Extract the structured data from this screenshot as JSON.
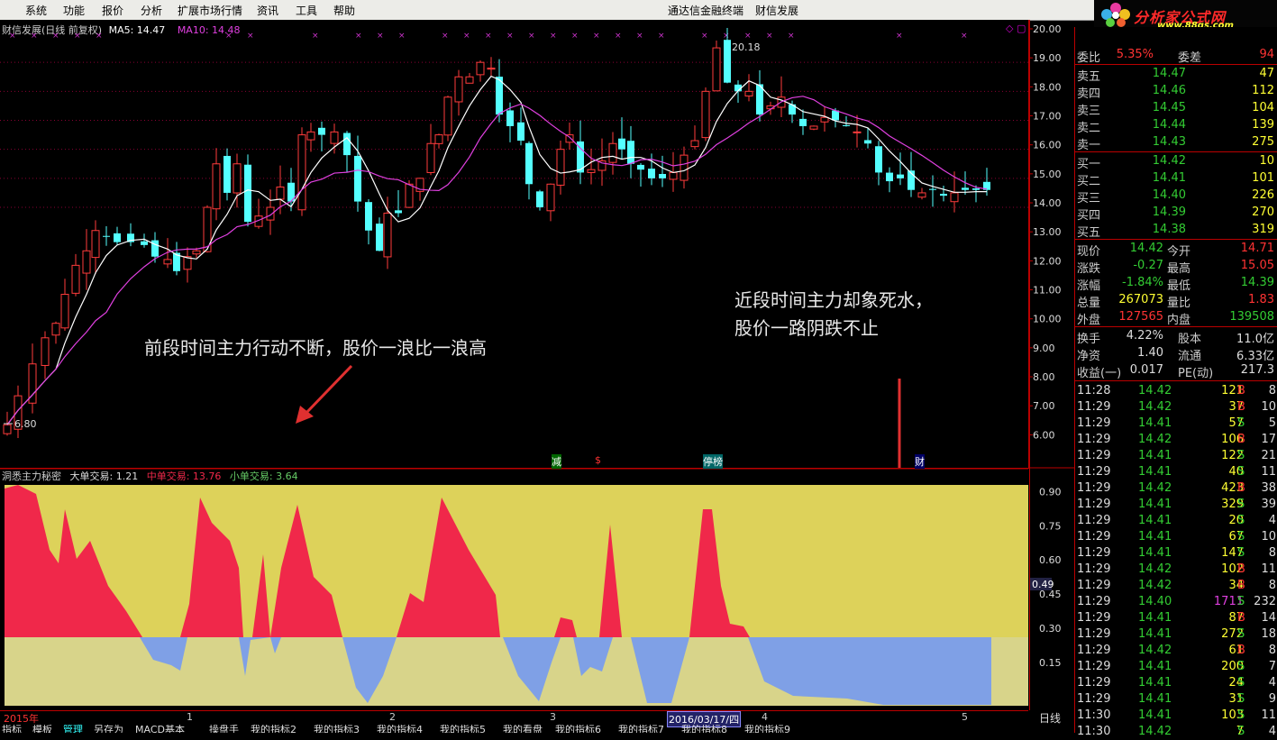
{
  "menu": {
    "items": [
      "系统",
      "功能",
      "报价",
      "分析",
      "扩展市场行情",
      "资讯",
      "工具",
      "帮助"
    ],
    "center_title": "通达信金融终端",
    "stock_name": "财信发展"
  },
  "logo": {
    "text": "分析家公式网",
    "url": "www.88gs.com"
  },
  "kline": {
    "header": "财信发展(日线 前复权)",
    "ma5_label": "MA5: 14.47",
    "ma10_label": "MA10: 14.48",
    "high_label": "20.18",
    "low_label": "6.80",
    "price_axis": [
      "20.00",
      "19.00",
      "18.00",
      "17.00",
      "16.00",
      "15.00",
      "14.00",
      "13.00",
      "12.00",
      "11.00",
      "10.00",
      "9.00",
      "8.00",
      "7.00",
      "6.00"
    ],
    "annotation_left": "前段时间主力行动不断，股价一浪比一浪高",
    "annotation_right_1": "近段时间主力却象死水，",
    "annotation_right_2": "股价一路阴跌不止",
    "event_markers": [
      "减",
      "$",
      "停榜",
      "财"
    ]
  },
  "indicator": {
    "name": "洞悉主力秘密",
    "big": "大单交易: 1.21",
    "mid": "中单交易: 13.76",
    "small": "小单交易: 3.64",
    "axis": [
      "0.90",
      "0.75",
      "0.60",
      "0.45",
      "0.30",
      "0.15"
    ],
    "current": "0.49",
    "colors": {
      "up": "#f0284a",
      "down": "#7fa0e6",
      "bg_top": "#ddd25a",
      "bg_bottom": "#d8d48a"
    }
  },
  "timeline": {
    "year": "2015年",
    "months": [
      "1",
      "2",
      "3",
      "4",
      "5"
    ],
    "cursor_date": "2016/03/17/四",
    "period": "日线"
  },
  "tabs": [
    "指标",
    "模板",
    "管理",
    "另存为",
    "MACD基本",
    "操盘手",
    "我的指标2",
    "我的指标3",
    "我的指标4",
    "我的指标5",
    "我的看盘",
    "我的指标6",
    "我的指标7",
    "我的指标8",
    "我的指标9"
  ],
  "quote": {
    "top": {
      "label1": "委比",
      "value1": "5.35%",
      "label2": "委差",
      "value2": "94"
    },
    "asks": [
      {
        "label": "卖五",
        "price": "14.47",
        "vol": "47"
      },
      {
        "label": "卖四",
        "price": "14.46",
        "vol": "112"
      },
      {
        "label": "卖三",
        "price": "14.45",
        "vol": "104"
      },
      {
        "label": "卖二",
        "price": "14.44",
        "vol": "139"
      },
      {
        "label": "卖一",
        "price": "14.43",
        "vol": "275"
      }
    ],
    "bids": [
      {
        "label": "买一",
        "price": "14.42",
        "vol": "10"
      },
      {
        "label": "买二",
        "price": "14.41",
        "vol": "101"
      },
      {
        "label": "买三",
        "price": "14.40",
        "vol": "226"
      },
      {
        "label": "买四",
        "price": "14.39",
        "vol": "270"
      },
      {
        "label": "买五",
        "price": "14.38",
        "vol": "319"
      }
    ],
    "stats": [
      {
        "l1": "现价",
        "v1": "14.42",
        "l2": "今开",
        "v2": "14.71"
      },
      {
        "l1": "涨跌",
        "v1": "-0.27",
        "l2": "最高",
        "v2": "15.05"
      },
      {
        "l1": "涨幅",
        "v1": "-1.84%",
        "l2": "最低",
        "v2": "14.39"
      },
      {
        "l1": "总量",
        "v1": "267073",
        "l2": "量比",
        "v2": "1.83"
      },
      {
        "l1": "外盘",
        "v1": "127565",
        "l2": "内盘",
        "v2": "139508"
      }
    ],
    "fund": [
      {
        "l1": "换手",
        "v1": "4.22%",
        "l2": "股本",
        "v2": "11.0亿"
      },
      {
        "l1": "净资",
        "v1": "1.40",
        "l2": "流通",
        "v2": "6.33亿"
      },
      {
        "l1": "收益(一)",
        "v1": "0.017",
        "l2": "PE(动)",
        "v2": "217.3"
      }
    ],
    "ticks": [
      {
        "t": "11:28",
        "p": "14.42",
        "v": "121",
        "s": "B",
        "n": "8"
      },
      {
        "t": "11:29",
        "p": "14.42",
        "v": "37",
        "s": "B",
        "n": "10"
      },
      {
        "t": "11:29",
        "p": "14.41",
        "v": "57",
        "s": "S",
        "n": "5"
      },
      {
        "t": "11:29",
        "p": "14.42",
        "v": "106",
        "s": "B",
        "n": "17"
      },
      {
        "t": "11:29",
        "p": "14.41",
        "v": "122",
        "s": "S",
        "n": "21"
      },
      {
        "t": "11:29",
        "p": "14.41",
        "v": "40",
        "s": "S",
        "n": "11"
      },
      {
        "t": "11:29",
        "p": "14.42",
        "v": "423",
        "s": "B",
        "n": "38"
      },
      {
        "t": "11:29",
        "p": "14.41",
        "v": "329",
        "s": "S",
        "n": "39"
      },
      {
        "t": "11:29",
        "p": "14.41",
        "v": "20",
        "s": "S",
        "n": "4"
      },
      {
        "t": "11:29",
        "p": "14.41",
        "v": "67",
        "s": "S",
        "n": "10"
      },
      {
        "t": "11:29",
        "p": "14.41",
        "v": "147",
        "s": "S",
        "n": "8"
      },
      {
        "t": "11:29",
        "p": "14.42",
        "v": "102",
        "s": "B",
        "n": "11"
      },
      {
        "t": "11:29",
        "p": "14.42",
        "v": "34",
        "s": "B",
        "n": "8"
      },
      {
        "t": "11:29",
        "p": "14.40",
        "v": "1711",
        "s": "S",
        "n": "232"
      },
      {
        "t": "11:29",
        "p": "14.41",
        "v": "87",
        "s": "B",
        "n": "14"
      },
      {
        "t": "11:29",
        "p": "14.41",
        "v": "272",
        "s": "S",
        "n": "18"
      },
      {
        "t": "11:29",
        "p": "14.42",
        "v": "61",
        "s": "B",
        "n": "8"
      },
      {
        "t": "11:29",
        "p": "14.41",
        "v": "200",
        "s": "S",
        "n": "7"
      },
      {
        "t": "11:29",
        "p": "14.41",
        "v": "24",
        "s": "S",
        "n": "4"
      },
      {
        "t": "11:29",
        "p": "14.41",
        "v": "31",
        "s": "S",
        "n": "9"
      },
      {
        "t": "11:30",
        "p": "14.41",
        "v": "103",
        "s": "S",
        "n": "11"
      },
      {
        "t": "11:30",
        "p": "14.42",
        "v": "7",
        "s": "S",
        "n": "4"
      }
    ]
  }
}
